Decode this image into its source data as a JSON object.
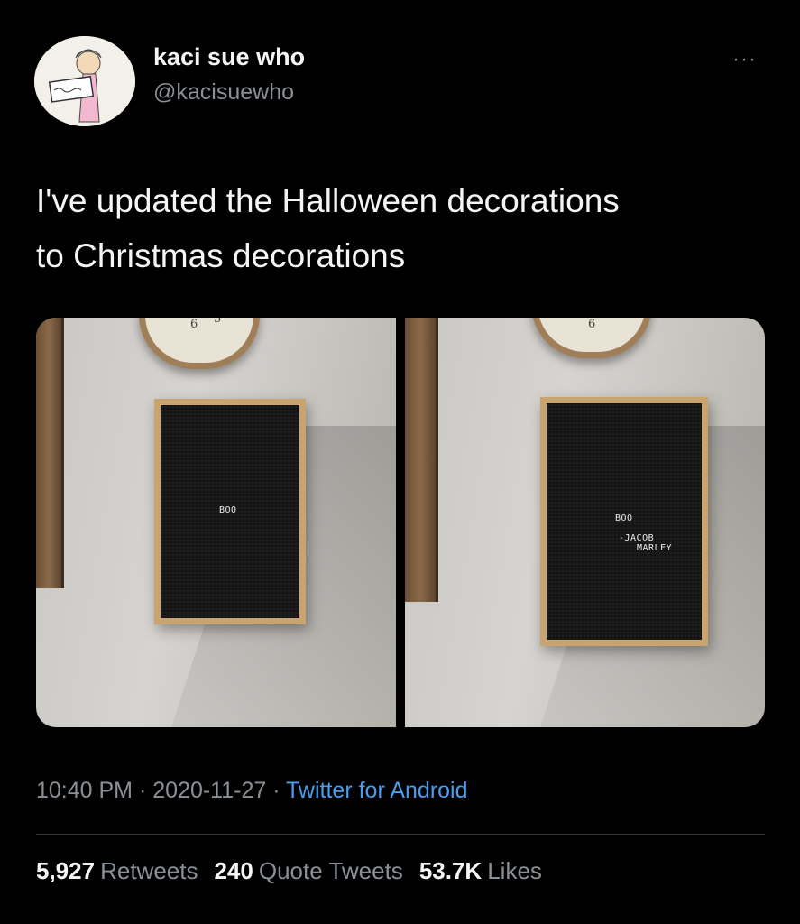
{
  "author": {
    "display_name": "kaci sue who",
    "handle": "@kacisuewho"
  },
  "more_icon": "ellipsis-icon",
  "tweet": {
    "line1": "I've updated the Halloween decorations",
    "line2": "to Christmas decorations"
  },
  "photos": [
    {
      "board_text": "BOO",
      "clock_digits": [
        "6",
        "5"
      ]
    },
    {
      "board_text": "BOO",
      "signature_line1": "-JACOB",
      "signature_line2": "MARLEY",
      "clock_digits": [
        "6"
      ]
    }
  ],
  "meta": {
    "time": "10:40 PM",
    "separator": " · ",
    "date": "2020-11-27",
    "separator2": " · ",
    "client": "Twitter for Android"
  },
  "stats": {
    "retweets_count": "5,927",
    "retweets_label": "Retweets",
    "quotes_count": "240",
    "quotes_label": "Quote Tweets",
    "likes_count": "53.7K",
    "likes_label": "Likes"
  },
  "colors": {
    "background": "#000000",
    "link": "#4a9ced",
    "muted": "#8b9096"
  }
}
